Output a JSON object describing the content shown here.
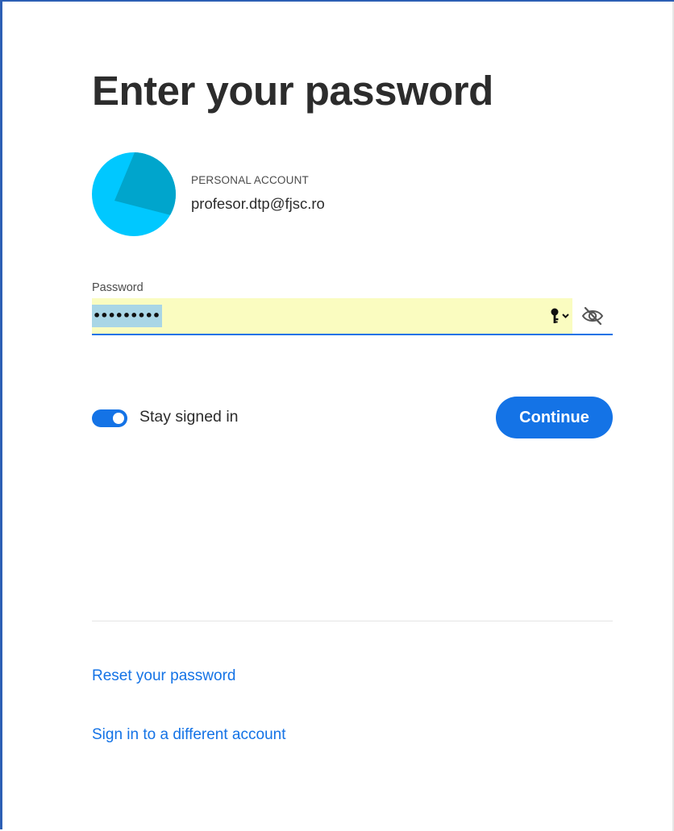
{
  "page": {
    "title": "Enter your password"
  },
  "account": {
    "type_label": "PERSONAL ACCOUNT",
    "email": "profesor.dtp@fjsc.ro",
    "avatar_color": "#00c8ff"
  },
  "password": {
    "label": "Password",
    "masked_value": "•••••••••",
    "autofill_color": "#fafcc0",
    "selection_color": "#a9d6e6",
    "keychain_icon": "key-icon",
    "toggle_visibility_icon": "eye-slash-icon"
  },
  "stay_signed_in": {
    "label": "Stay signed in",
    "enabled": true
  },
  "actions": {
    "continue_label": "Continue",
    "accent_color": "#1473e6"
  },
  "links": {
    "reset": "Reset your password",
    "different_account": "Sign in to a different account"
  }
}
